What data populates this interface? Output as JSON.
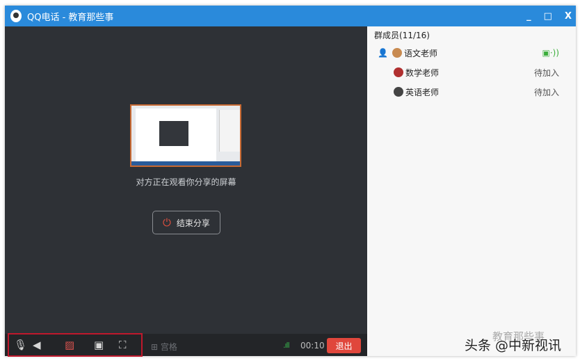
{
  "window": {
    "title": "QQ电话 - 教育那些事",
    "minimize": "_",
    "maximize": "□",
    "close": "X"
  },
  "share": {
    "status": "对方正在观看你分享的屏幕",
    "end_button": "结束分享"
  },
  "toolbar": {
    "grid_label": "宫格",
    "signal": ".ıll",
    "timer": "00:10",
    "quit": "退出"
  },
  "members": {
    "header": "群成员(11/16)",
    "list": [
      {
        "name": "语文老师",
        "status": "▣·))"
      },
      {
        "name": "数学老师",
        "status": "待加入"
      },
      {
        "name": "英语老师",
        "status": "待加入"
      }
    ]
  },
  "watermark": {
    "top": "教育那些事",
    "bottom": "头条 @中新视讯"
  },
  "colors": {
    "titlebar": "#2a8adb",
    "quit": "#e0473c",
    "highlight": "#c0182c"
  }
}
